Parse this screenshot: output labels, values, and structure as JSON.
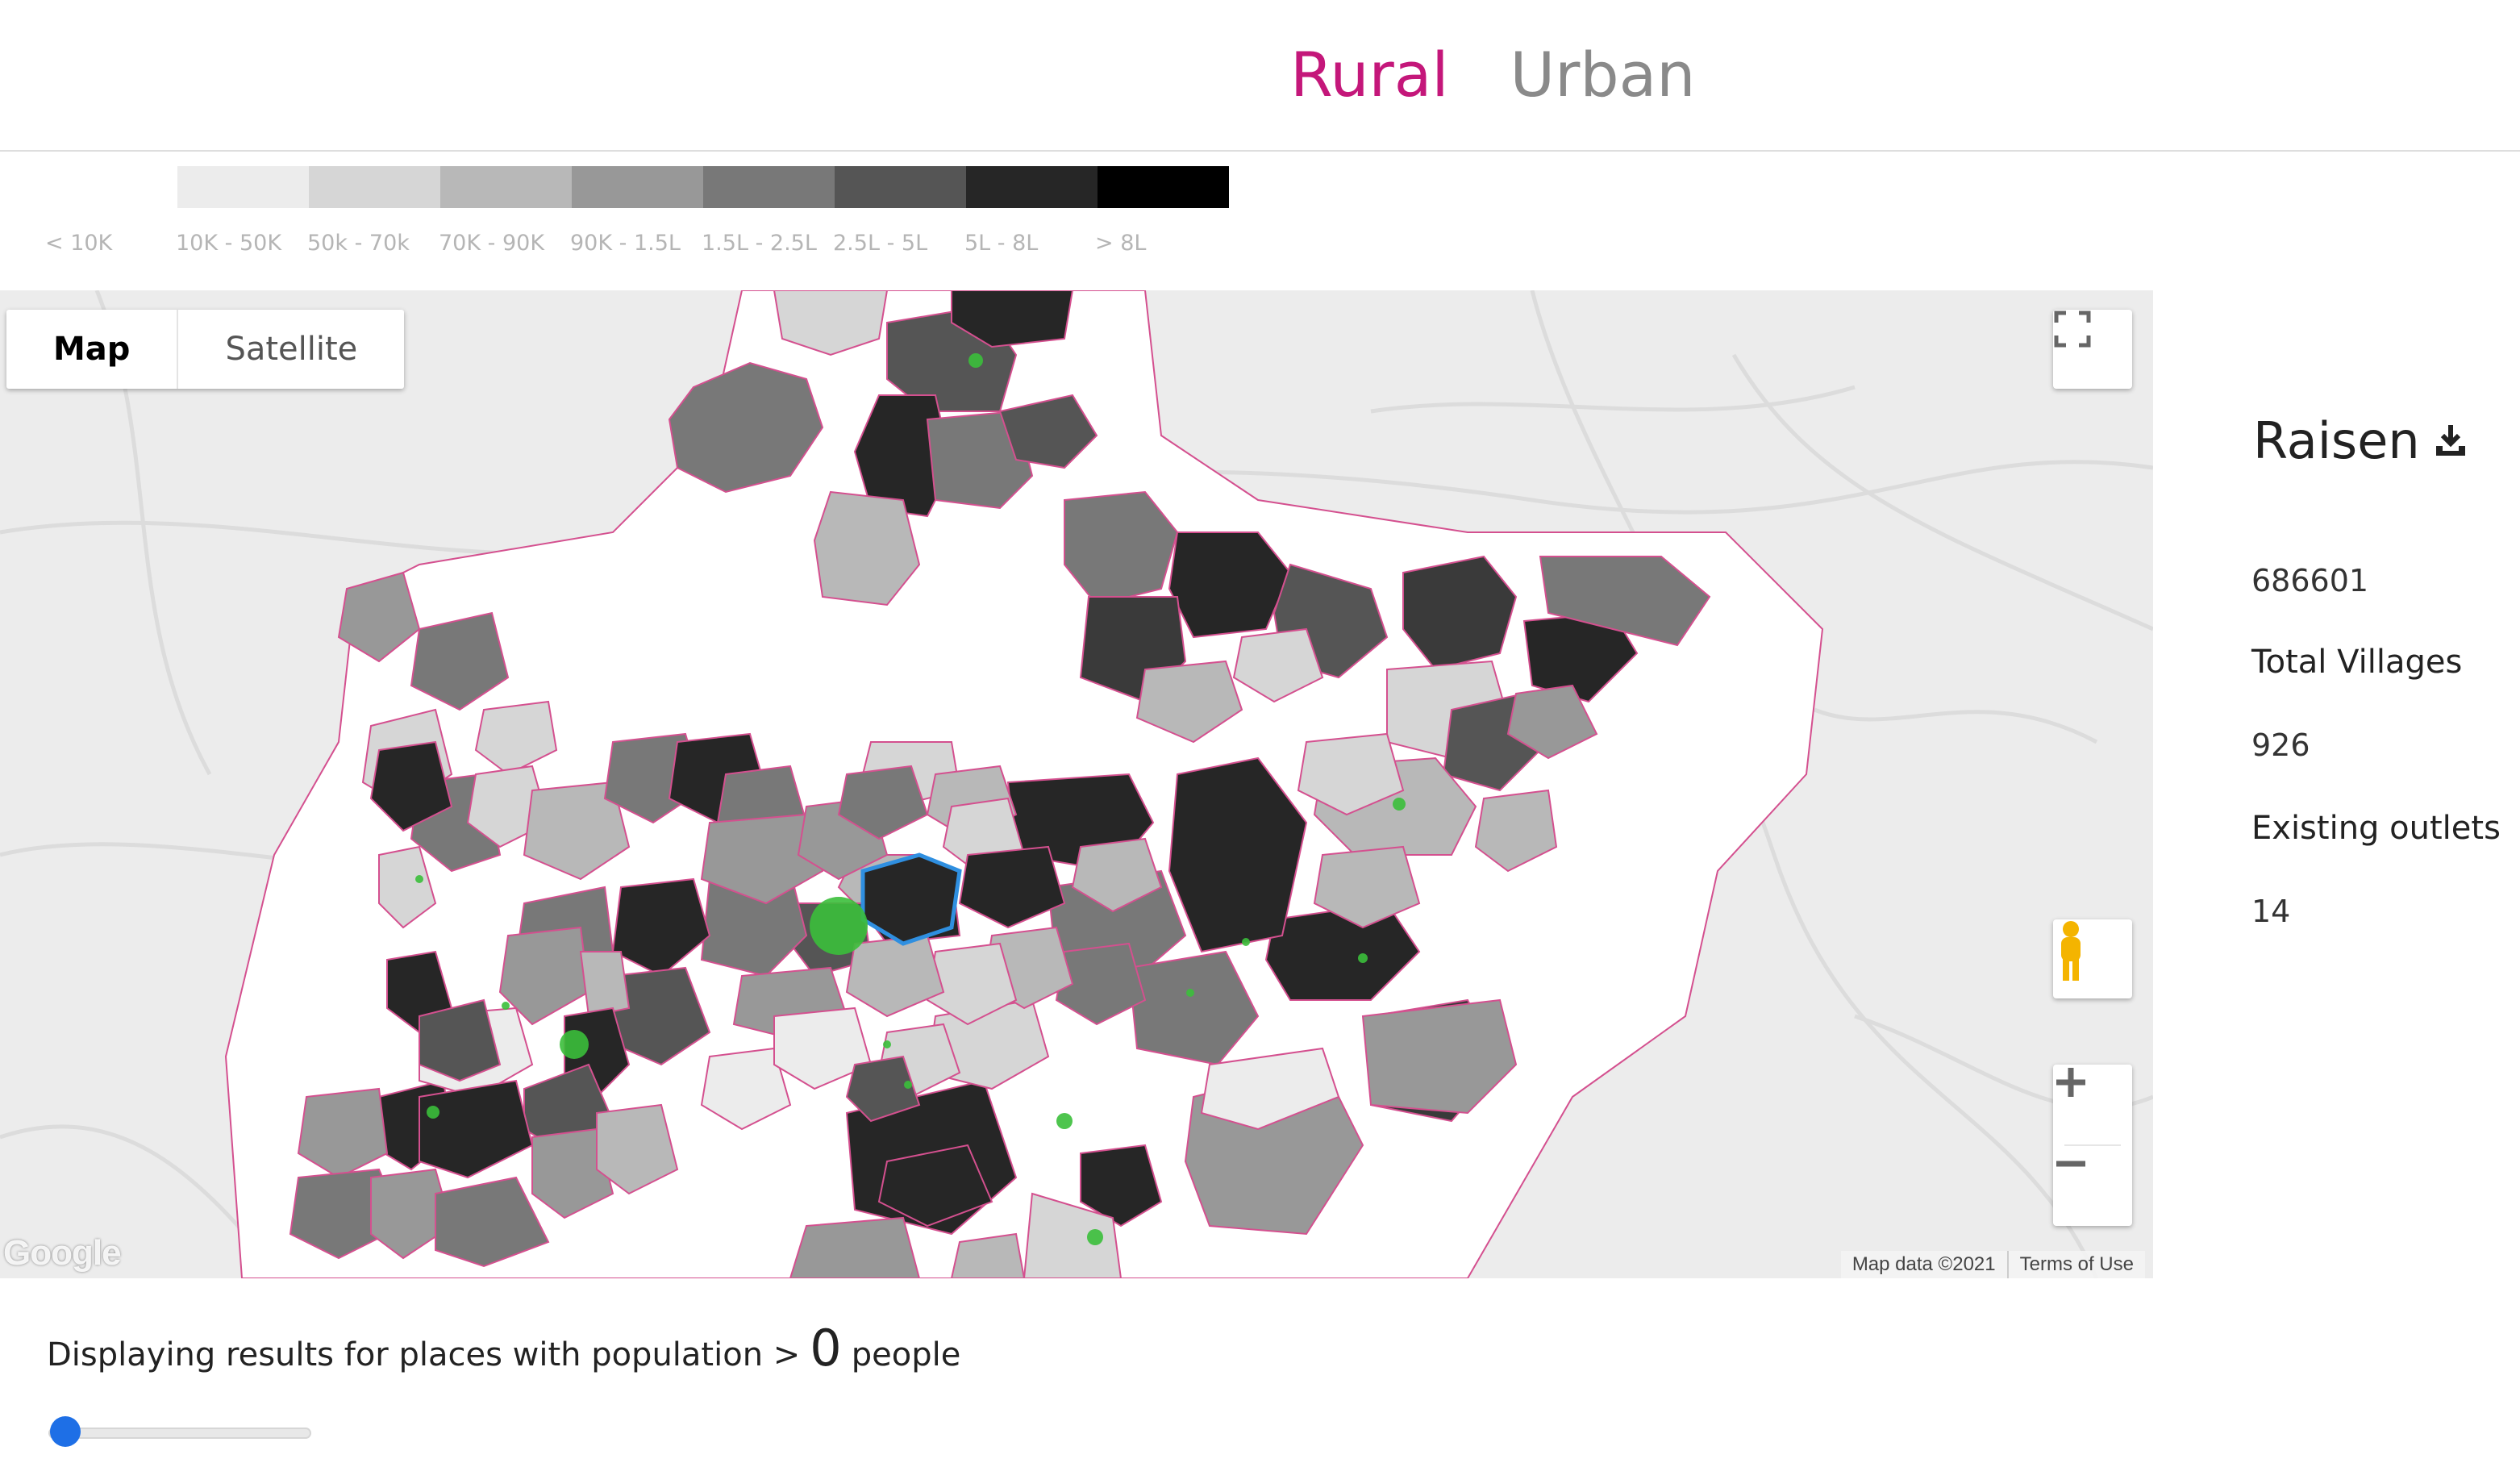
{
  "tabs": [
    {
      "label": "Rural",
      "active": true
    },
    {
      "label": "Urban",
      "active": false
    }
  ],
  "legend": {
    "swatch_colors": [
      "#ececec",
      "#d6d6d6",
      "#b8b8b8",
      "#989898",
      "#787878",
      "#555555",
      "#262626",
      "#000000"
    ],
    "labels": [
      "< 10K",
      "10K - 50K",
      "50k - 70k",
      "70K - 90K",
      "90K - 1.5L",
      "1.5L - 2.5L",
      "2.5L - 5L",
      "5L - 8L",
      "> 8L"
    ]
  },
  "map": {
    "type_buttons": [
      "Map",
      "Satellite"
    ],
    "selected_type": "Map",
    "attribution": "Map data ©2021",
    "terms_label": "Terms of Use",
    "logo_text": "Google",
    "boundary_color": "#d4508f",
    "marker_color": "#3bbf3b",
    "selected_color": "#2f8fe0",
    "icons": {
      "fullscreen": "fullscreen-icon",
      "pegman": "pegman-icon",
      "zoom_in": "plus-icon",
      "zoom_out": "minus-icon"
    }
  },
  "panel": {
    "district": "Raisen",
    "population": "686601",
    "villages_label": "Total Villages",
    "villages_value": "926",
    "outlets_label": "Existing outlets",
    "outlets_value": "14",
    "download_icon": "download-icon"
  },
  "footer": {
    "prefix": "Displaying results for places with population >",
    "threshold": "0",
    "suffix": "people"
  },
  "slider": {
    "value": 0
  }
}
